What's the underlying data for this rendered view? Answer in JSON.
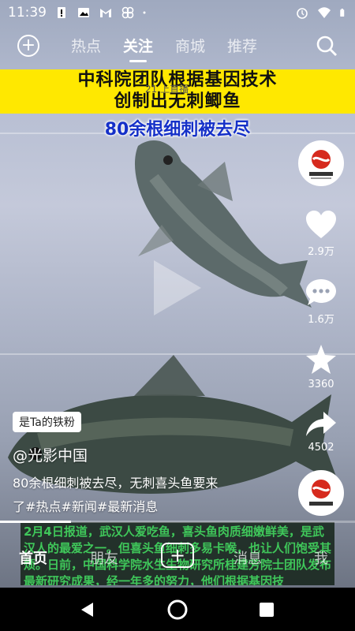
{
  "status_bar": {
    "time": "11:39",
    "icons_left": [
      "alert-icon",
      "image-icon",
      "gmail-icon",
      "pinwheel-icon",
      "dot-icon"
    ],
    "icons_right": [
      "alarm-icon",
      "wifi-icon",
      "battery-icon"
    ]
  },
  "top_nav": {
    "tabs": [
      {
        "label": "热点",
        "active": false
      },
      {
        "label": "关注",
        "active": true
      },
      {
        "label": "商城",
        "active": false
      },
      {
        "label": "推荐",
        "active": false
      }
    ]
  },
  "video": {
    "headline_line1": "中科院团队根据基因技术",
    "headline_line2": "创制出无刺鲫鱼",
    "live_label": "21 上直播",
    "subheadline": "80余根细刺被去尽",
    "progress": 0.2
  },
  "actions": {
    "likes": "2.9万",
    "comments": "1.6万",
    "favorites": "3360",
    "shares": "4502"
  },
  "post": {
    "fan_badge": "是Ta的铁粉",
    "author": "@光影中国",
    "description_line1": "80余根细刺被去尽，无刺喜头鱼要来",
    "description_line2": "了#热点#新闻#最新消息"
  },
  "caption_text": "2月4日报道，武汉人爱吃鱼，喜头鱼肉质细嫩鲜美，是武汉人的最爱之一。但喜头鱼细刺多易卡喉，也让人们饱受其烦。日前，中国科学院水生生物研究所桂建芳院士团队发布最新研究成果，经一年多的努力，他们根据基因技",
  "bottom_nav": {
    "home": "首页",
    "friends": "朋友",
    "messages": "消息",
    "me": "我"
  },
  "colors": {
    "banner": "#ffe800",
    "subheadline": "#1530c8",
    "caption": "#3fc75a"
  }
}
